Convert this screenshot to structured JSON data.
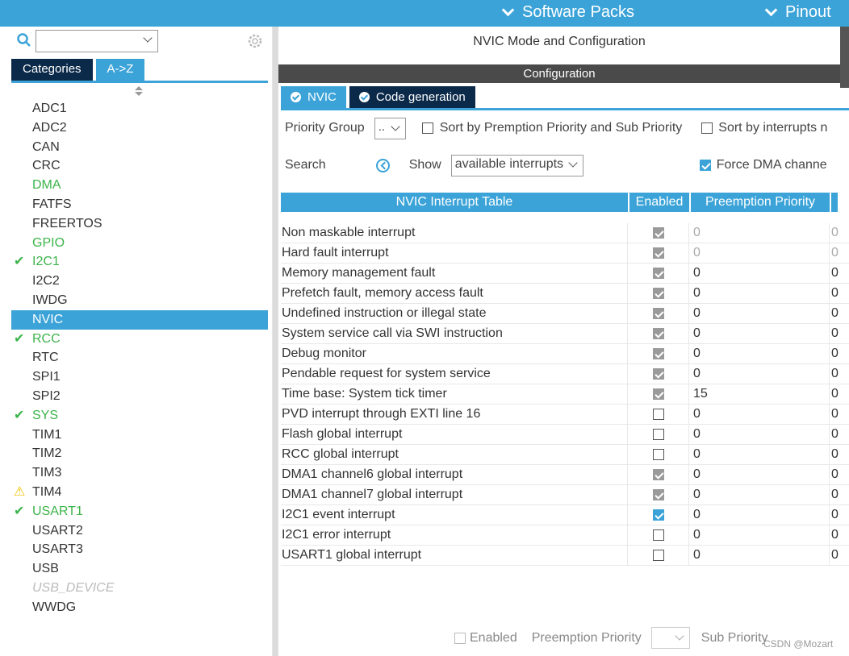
{
  "topbar": {
    "software_packs": "Software Packs",
    "pinout": "Pinout"
  },
  "sidebar": {
    "tab_categories": "Categories",
    "tab_az": "A->Z",
    "items": [
      {
        "label": "ADC1",
        "state": "normal"
      },
      {
        "label": "ADC2",
        "state": "normal"
      },
      {
        "label": "CAN",
        "state": "normal"
      },
      {
        "label": "CRC",
        "state": "normal"
      },
      {
        "label": "DMA",
        "state": "green"
      },
      {
        "label": "FATFS",
        "state": "normal"
      },
      {
        "label": "FREERTOS",
        "state": "normal"
      },
      {
        "label": "GPIO",
        "state": "green"
      },
      {
        "label": "I2C1",
        "state": "checked"
      },
      {
        "label": "I2C2",
        "state": "normal"
      },
      {
        "label": "IWDG",
        "state": "normal"
      },
      {
        "label": "NVIC",
        "state": "selected"
      },
      {
        "label": "RCC",
        "state": "checked"
      },
      {
        "label": "RTC",
        "state": "normal"
      },
      {
        "label": "SPI1",
        "state": "normal"
      },
      {
        "label": "SPI2",
        "state": "normal"
      },
      {
        "label": "SYS",
        "state": "checked"
      },
      {
        "label": "TIM1",
        "state": "normal"
      },
      {
        "label": "TIM2",
        "state": "normal"
      },
      {
        "label": "TIM3",
        "state": "normal"
      },
      {
        "label": "TIM4",
        "state": "warning"
      },
      {
        "label": "USART1",
        "state": "checked"
      },
      {
        "label": "USART2",
        "state": "normal"
      },
      {
        "label": "USART3",
        "state": "normal"
      },
      {
        "label": "USB",
        "state": "normal"
      },
      {
        "label": "USB_DEVICE",
        "state": "disabled"
      },
      {
        "label": "WWDG",
        "state": "normal"
      }
    ]
  },
  "main": {
    "title": "NVIC Mode and Configuration",
    "config_header": "Configuration",
    "tab_nvic": "NVIC",
    "tab_codegen": "Code generation",
    "priority_group_label": "Priority Group",
    "priority_group_value": "..",
    "sort_premption_label": "Sort by Premption Priority and Sub Priority",
    "sort_interrupts_label": "Sort by interrupts n",
    "search_label": "Search",
    "show_label": "Show",
    "show_value": "available interrupts",
    "force_dma_label": "Force DMA channe",
    "table_headers": {
      "name": "NVIC Interrupt Table",
      "enabled": "Enabled",
      "preemption": "Preemption Priority"
    },
    "rows": [
      {
        "name": "Non maskable interrupt",
        "enabled": "locked",
        "preemption": "0",
        "sub": "0",
        "dim": true
      },
      {
        "name": "Hard fault interrupt",
        "enabled": "locked",
        "preemption": "0",
        "sub": "0",
        "dim": true
      },
      {
        "name": "Memory management fault",
        "enabled": "locked",
        "preemption": "0",
        "sub": "0",
        "dim": false
      },
      {
        "name": "Prefetch fault, memory access fault",
        "enabled": "locked",
        "preemption": "0",
        "sub": "0",
        "dim": false
      },
      {
        "name": "Undefined instruction or illegal state",
        "enabled": "locked",
        "preemption": "0",
        "sub": "0",
        "dim": false
      },
      {
        "name": "System service call via SWI instruction",
        "enabled": "locked",
        "preemption": "0",
        "sub": "0",
        "dim": false
      },
      {
        "name": "Debug monitor",
        "enabled": "locked",
        "preemption": "0",
        "sub": "0",
        "dim": false
      },
      {
        "name": "Pendable request for system service",
        "enabled": "locked",
        "preemption": "0",
        "sub": "0",
        "dim": false
      },
      {
        "name": "Time base: System tick timer",
        "enabled": "locked",
        "preemption": "15",
        "sub": "0",
        "dim": false
      },
      {
        "name": "PVD interrupt through EXTI line 16",
        "enabled": "off",
        "preemption": "0",
        "sub": "0",
        "dim": false
      },
      {
        "name": "Flash global interrupt",
        "enabled": "off",
        "preemption": "0",
        "sub": "0",
        "dim": false
      },
      {
        "name": "RCC global interrupt",
        "enabled": "off",
        "preemption": "0",
        "sub": "0",
        "dim": false
      },
      {
        "name": "DMA1 channel6 global interrupt",
        "enabled": "locked",
        "preemption": "0",
        "sub": "0",
        "dim": false
      },
      {
        "name": "DMA1 channel7 global interrupt",
        "enabled": "locked",
        "preemption": "0",
        "sub": "0",
        "dim": false
      },
      {
        "name": "I2C1 event interrupt",
        "enabled": "on",
        "preemption": "0",
        "sub": "0",
        "dim": false
      },
      {
        "name": "I2C1 error interrupt",
        "enabled": "off",
        "preemption": "0",
        "sub": "0",
        "dim": false
      },
      {
        "name": "USART1 global interrupt",
        "enabled": "off",
        "preemption": "0",
        "sub": "0",
        "dim": false
      }
    ],
    "bottom": {
      "enabled_label": "Enabled",
      "preemption_label": "Preemption Priority",
      "sub_label": "Sub Priority"
    }
  },
  "watermark": "CSDN @Mozart",
  "colors": {
    "accent": "#3ba3d8",
    "dark_tab": "#0b2a4a",
    "green": "#3cb44b",
    "warning": "#f2c200"
  }
}
